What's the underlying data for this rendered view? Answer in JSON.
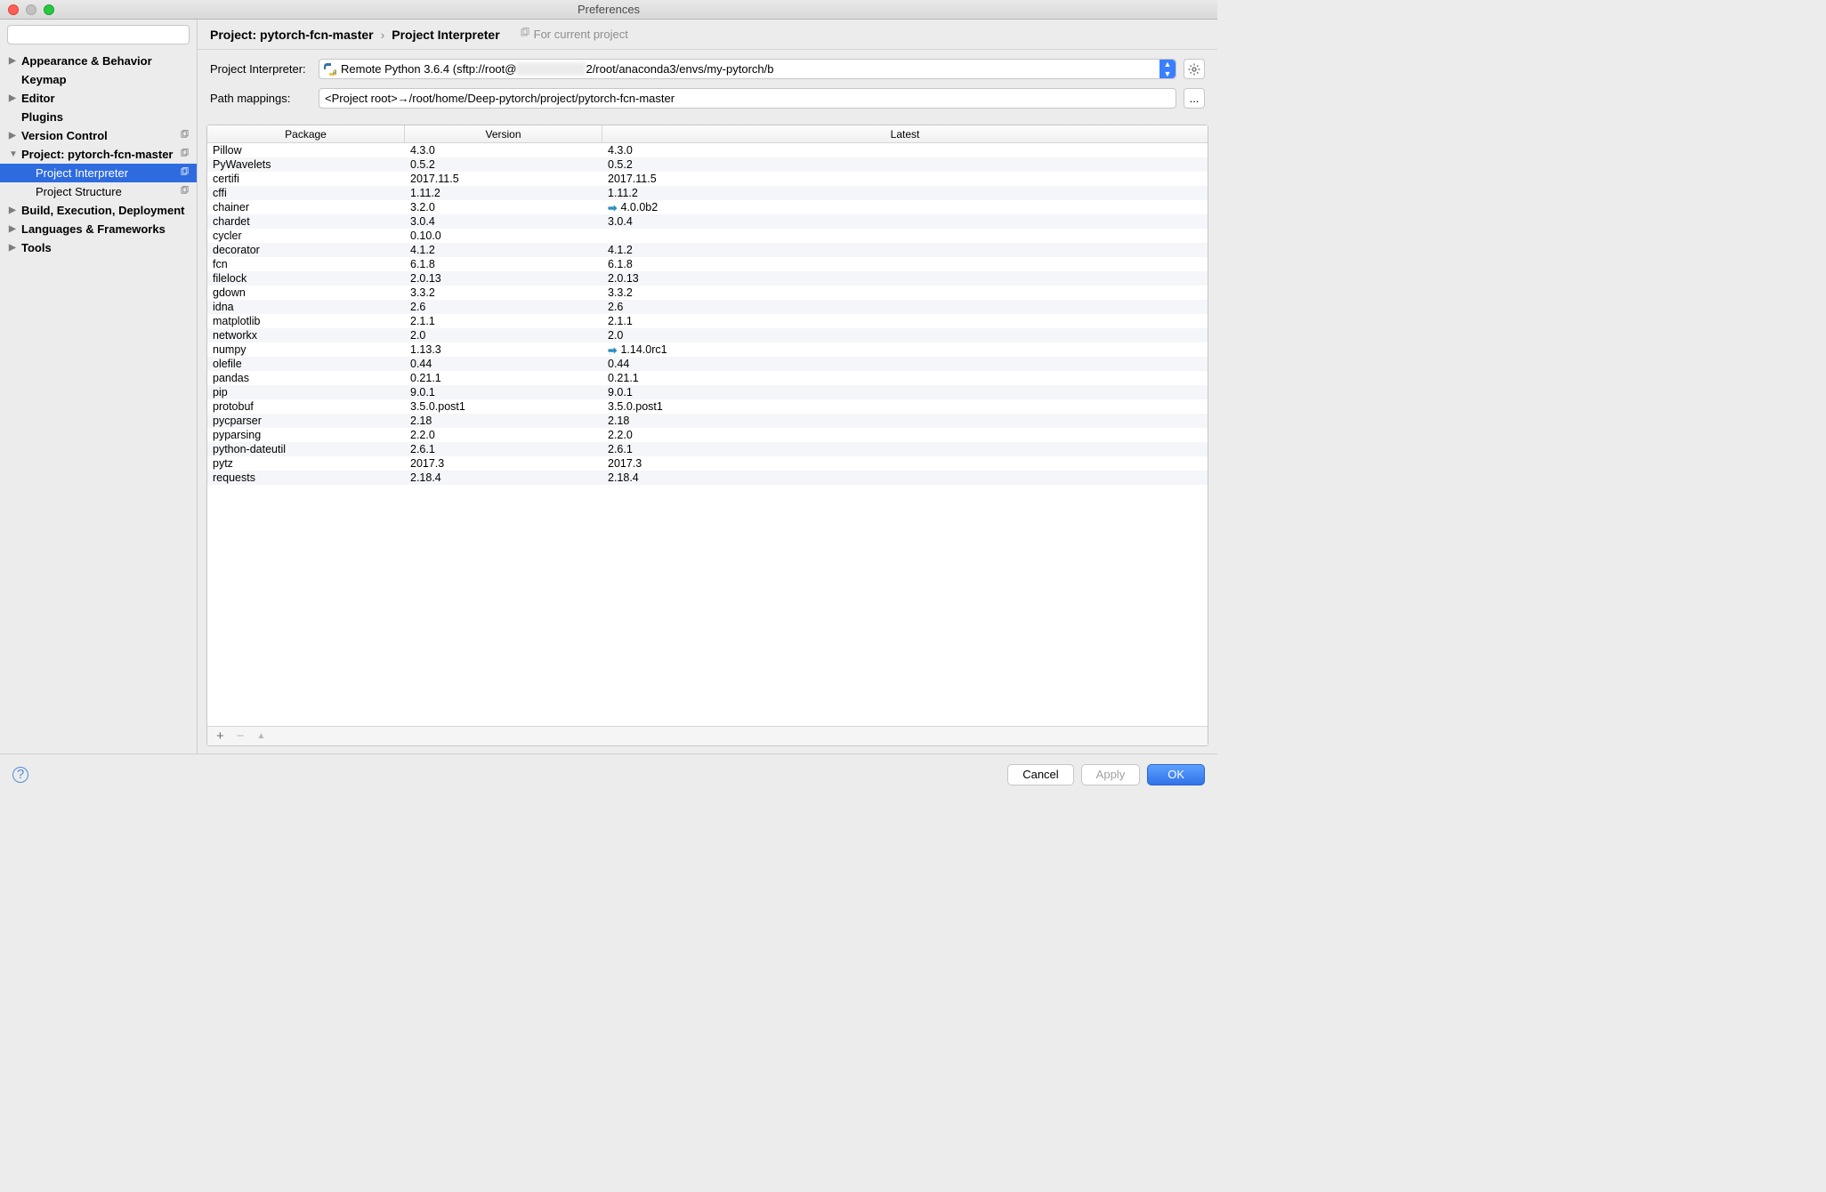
{
  "window": {
    "title": "Preferences"
  },
  "sidebar": {
    "search_placeholder": "",
    "items": [
      {
        "label": "Appearance & Behavior",
        "bold": true,
        "arrow": "▶"
      },
      {
        "label": "Keymap",
        "bold": true,
        "arrow": ""
      },
      {
        "label": "Editor",
        "bold": true,
        "arrow": "▶"
      },
      {
        "label": "Plugins",
        "bold": true,
        "arrow": ""
      },
      {
        "label": "Version Control",
        "bold": true,
        "arrow": "▶",
        "copy": true
      },
      {
        "label": "Project: pytorch-fcn-master",
        "bold": true,
        "arrow": "▼",
        "copy": true
      },
      {
        "label": "Project Interpreter",
        "child": true,
        "selected": true,
        "copy": true
      },
      {
        "label": "Project Structure",
        "child": true,
        "copy": true
      },
      {
        "label": "Build, Execution, Deployment",
        "bold": true,
        "arrow": "▶"
      },
      {
        "label": "Languages & Frameworks",
        "bold": true,
        "arrow": "▶"
      },
      {
        "label": "Tools",
        "bold": true,
        "arrow": "▶"
      }
    ]
  },
  "breadcrumb": {
    "p1": "Project: pytorch-fcn-master",
    "sep": "›",
    "p2": "Project Interpreter",
    "hint": "For current project"
  },
  "form": {
    "interp_label": "Project Interpreter:",
    "interp_value_prefix": "Remote Python 3.6.4 (sftp://root@",
    "interp_value_suffix": "2/root/anaconda3/envs/my-pytorch/b",
    "path_label": "Path mappings:",
    "path_value": "<Project root>→/root/home/Deep-pytorch/project/pytorch-fcn-master",
    "ellipsis": "..."
  },
  "table": {
    "headers": {
      "pkg": "Package",
      "ver": "Version",
      "lat": "Latest"
    },
    "rows": [
      {
        "pkg": "Pillow",
        "ver": "4.3.0",
        "lat": "4.3.0"
      },
      {
        "pkg": "PyWavelets",
        "ver": "0.5.2",
        "lat": "0.5.2"
      },
      {
        "pkg": "certifi",
        "ver": "2017.11.5",
        "lat": "2017.11.5"
      },
      {
        "pkg": "cffi",
        "ver": "1.11.2",
        "lat": "1.11.2"
      },
      {
        "pkg": "chainer",
        "ver": "3.2.0",
        "lat": "4.0.0b2",
        "upd": true
      },
      {
        "pkg": "chardet",
        "ver": "3.0.4",
        "lat": "3.0.4"
      },
      {
        "pkg": "cycler",
        "ver": "0.10.0",
        "lat": ""
      },
      {
        "pkg": "decorator",
        "ver": "4.1.2",
        "lat": "4.1.2"
      },
      {
        "pkg": "fcn",
        "ver": "6.1.8",
        "lat": "6.1.8"
      },
      {
        "pkg": "filelock",
        "ver": "2.0.13",
        "lat": "2.0.13"
      },
      {
        "pkg": "gdown",
        "ver": "3.3.2",
        "lat": "3.3.2"
      },
      {
        "pkg": "idna",
        "ver": "2.6",
        "lat": "2.6"
      },
      {
        "pkg": "matplotlib",
        "ver": "2.1.1",
        "lat": "2.1.1"
      },
      {
        "pkg": "networkx",
        "ver": "2.0",
        "lat": "2.0"
      },
      {
        "pkg": "numpy",
        "ver": "1.13.3",
        "lat": "1.14.0rc1",
        "upd": true
      },
      {
        "pkg": "olefile",
        "ver": "0.44",
        "lat": "0.44"
      },
      {
        "pkg": "pandas",
        "ver": "0.21.1",
        "lat": "0.21.1"
      },
      {
        "pkg": "pip",
        "ver": "9.0.1",
        "lat": "9.0.1"
      },
      {
        "pkg": "protobuf",
        "ver": "3.5.0.post1",
        "lat": "3.5.0.post1"
      },
      {
        "pkg": "pycparser",
        "ver": "2.18",
        "lat": "2.18"
      },
      {
        "pkg": "pyparsing",
        "ver": "2.2.0",
        "lat": "2.2.0"
      },
      {
        "pkg": "python-dateutil",
        "ver": "2.6.1",
        "lat": "2.6.1"
      },
      {
        "pkg": "pytz",
        "ver": "2017.3",
        "lat": "2017.3"
      },
      {
        "pkg": "requests",
        "ver": "2.18.4",
        "lat": "2.18.4"
      }
    ]
  },
  "toolbar": {
    "add": "+",
    "remove": "−",
    "up": "▲"
  },
  "footer": {
    "help": "?",
    "cancel": "Cancel",
    "apply": "Apply",
    "ok": "OK"
  }
}
